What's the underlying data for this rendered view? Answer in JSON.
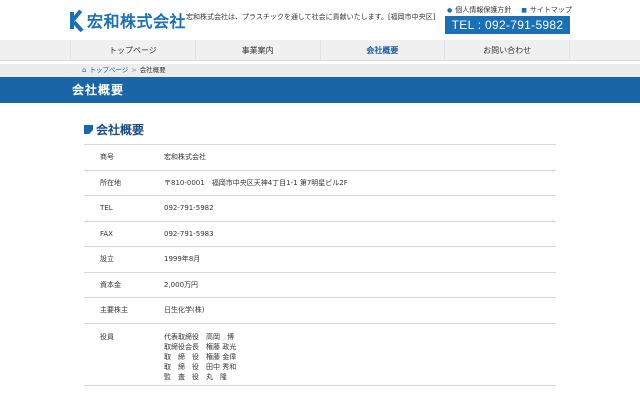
{
  "header": {
    "logo_text": "宏和株式会社",
    "tagline": "宏和株式会社は、プラスチックを通して社会に貢献いたします。[福岡市中央区]",
    "links": [
      {
        "label": "個人情報保護方針"
      },
      {
        "label": "サイトマップ"
      }
    ],
    "tel": "TEL : 092-791-5982"
  },
  "nav": {
    "items": [
      {
        "label": "トップページ"
      },
      {
        "label": "事業案内"
      },
      {
        "label": "会社概要"
      },
      {
        "label": "お問い合わせ"
      }
    ],
    "active_index": 2
  },
  "breadcrumb": {
    "home": "トップページ",
    "separator": ">",
    "current": "会社概要"
  },
  "page_title": "会社概要",
  "section_title": "会社概要",
  "company_info": {
    "rows": [
      {
        "key": "商号",
        "value": "宏和株式会社"
      },
      {
        "key": "所在地",
        "value": "〒810-0001　福岡市中央区天神4丁目1-1 第7明星ビル2F"
      },
      {
        "key": "TEL",
        "value": "092-791-5982"
      },
      {
        "key": "FAX",
        "value": "092-791-5983"
      },
      {
        "key": "設立",
        "value": "1999年8月"
      },
      {
        "key": "資本金",
        "value": "2,000万円"
      },
      {
        "key": "主要株主",
        "value": "日生化学(株)"
      }
    ],
    "officers_key": "役員",
    "officers": [
      "代表取締役　高岡　博",
      "取締役会長　権藤 政光",
      "取　締　役　権藤 金偉",
      "取　締　役　田中 秀和",
      "監　査　役　丸　隆"
    ]
  },
  "colors": {
    "brand_blue": "#1a6fb5",
    "band_blue": "#1a65a8"
  }
}
